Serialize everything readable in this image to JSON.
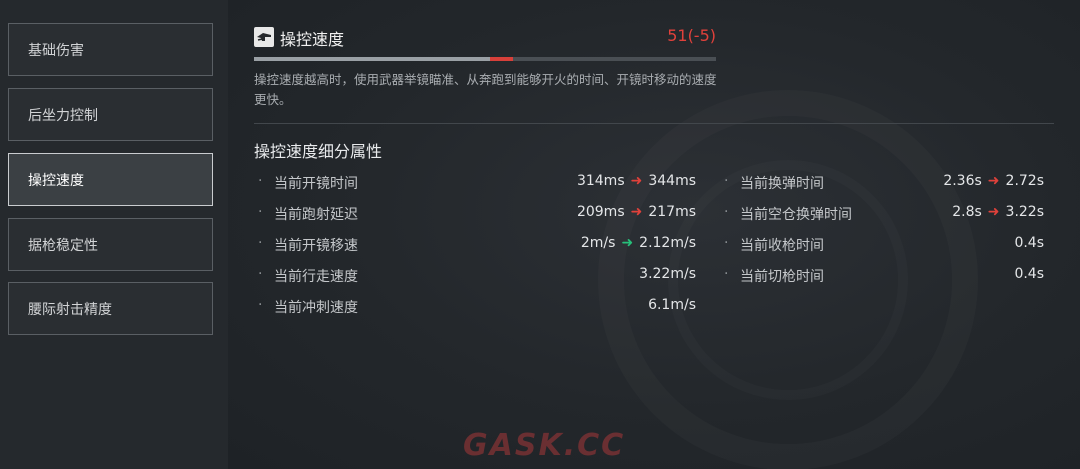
{
  "nav": {
    "items": [
      {
        "label": "基础伤害",
        "active": false
      },
      {
        "label": "后坐力控制",
        "active": false
      },
      {
        "label": "操控速度",
        "active": true
      },
      {
        "label": "据枪稳定性",
        "active": false
      },
      {
        "label": "腰际射击精度",
        "active": false
      }
    ]
  },
  "stat": {
    "icon": "weapon-handling-icon",
    "title": "操控速度",
    "value": "51(-5)",
    "bar": {
      "current": 51,
      "loss": 5,
      "max": 100
    },
    "description": "操控速度越高时，使用武器举镜瞄准、从奔跑到能够开火的时间、开镜时移动的速度更快。"
  },
  "details": {
    "title": "操控速度细分属性",
    "left": [
      {
        "label": "当前开镜时间",
        "from": "314ms",
        "to": "344ms",
        "change": "up"
      },
      {
        "label": "当前跑射延迟",
        "from": "209ms",
        "to": "217ms",
        "change": "up"
      },
      {
        "label": "当前开镜移速",
        "from": "2m/s",
        "to": "2.12m/s",
        "change": "down"
      },
      {
        "label": "当前行走速度",
        "from": "",
        "to": "3.22m/s",
        "change": "none"
      },
      {
        "label": "当前冲刺速度",
        "from": "",
        "to": "6.1m/s",
        "change": "none"
      }
    ],
    "right": [
      {
        "label": "当前换弹时间",
        "from": "2.36s",
        "to": "2.72s",
        "change": "up"
      },
      {
        "label": "当前空仓换弹时间",
        "from": "2.8s",
        "to": "3.22s",
        "change": "up"
      },
      {
        "label": "当前收枪时间",
        "from": "",
        "to": "0.4s",
        "change": "none"
      },
      {
        "label": "当前切枪时间",
        "from": "",
        "to": "0.4s",
        "change": "none"
      }
    ]
  },
  "watermark": "GASK.CC",
  "colors": {
    "worse": "#e0413b",
    "better": "#27c07a",
    "accent_value": "#e0413b"
  }
}
